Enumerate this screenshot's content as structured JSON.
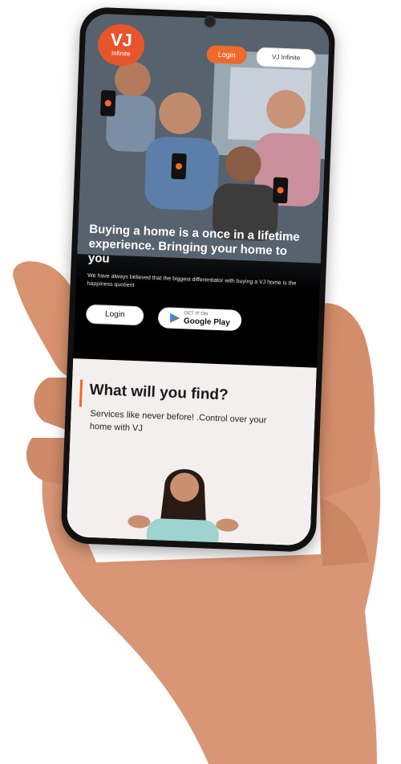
{
  "app": {
    "logo_text": "VJ",
    "logo_sub": "Infinite"
  },
  "header": {
    "orange_button_label": "Login",
    "white_button_label": "VJ Infinite"
  },
  "hero": {
    "headline": "Buying a home is a once in a lifetime experience. Bringing your home to you",
    "subtext": "We have always believed that the biggest differentiator with buying a VJ home is the happiness quotient",
    "login_label": "Login",
    "play_small": "GET IT ON",
    "play_label": "Google Play"
  },
  "section": {
    "title": "What will you find?",
    "subtitle": "Services like never before! .Control over your home with VJ"
  },
  "colors": {
    "accent": "#ee6a2c",
    "logo": "#e8552b",
    "section_bg": "#f4efef"
  }
}
